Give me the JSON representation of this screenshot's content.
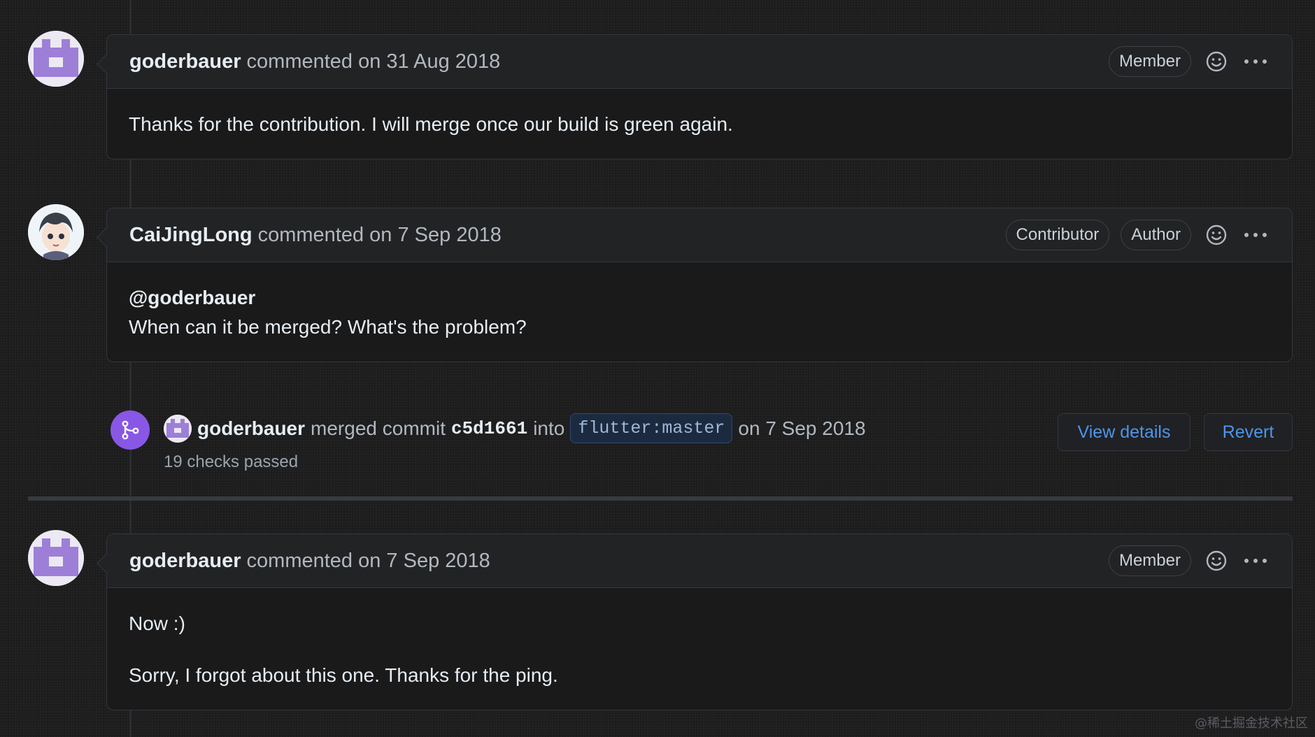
{
  "comments": [
    {
      "author": "goderbauer",
      "meta": "commented on 31 Aug 2018",
      "badges": [
        "Member"
      ],
      "body": [
        "Thanks for the contribution. I will merge once our build is green again."
      ]
    },
    {
      "author": "CaiJingLong",
      "meta": "commented on 7 Sep 2018",
      "badges": [
        "Contributor",
        "Author"
      ],
      "body": [
        "@goderbauer",
        "When can it be merged? What's the problem?"
      ]
    },
    {
      "author": "goderbauer",
      "meta": "commented on 7 Sep 2018",
      "badges": [
        "Member"
      ],
      "body": [
        "Now :)",
        "Sorry, I forgot about this one. Thanks for the ping."
      ]
    }
  ],
  "merge": {
    "author": "goderbauer",
    "text_merged": "merged commit",
    "sha": "c5d1661",
    "text_into": "into",
    "branch": "flutter:master",
    "date": "on 7 Sep 2018",
    "checks": "19 checks passed",
    "view_details": "View details",
    "revert": "Revert"
  },
  "watermark": "@稀土掘金技术社区",
  "colors": {
    "background": "#1d1d1e",
    "link": "#4e95ea",
    "merged_purple": "#8957e5",
    "identicon_purple": "#9d7fd8"
  }
}
